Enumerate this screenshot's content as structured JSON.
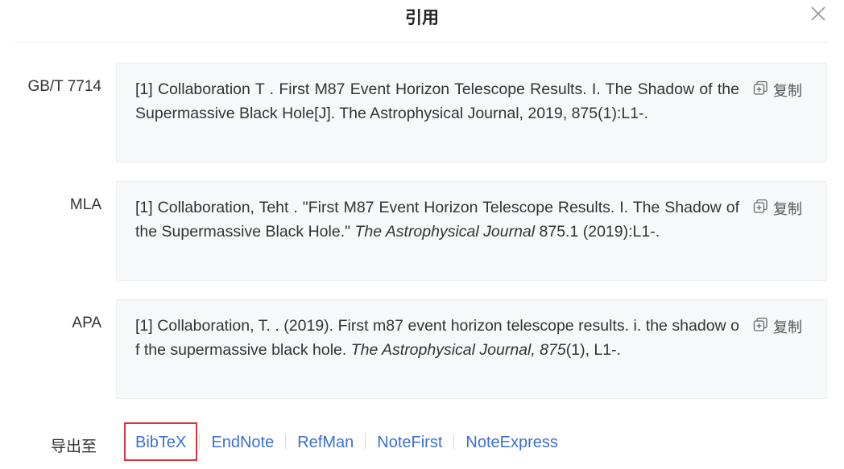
{
  "dialog": {
    "title": "引用",
    "close_icon": "close-icon"
  },
  "citations": [
    {
      "format": "GB/T 7714",
      "text": "[1] Collaboration T . First M87 Event Horizon Telescope Results. I. The Shadow of the Supermassive Black Hole[J]. The Astrophysical Journal, 2019, 875(1):L1-.",
      "copy_label": "复制"
    },
    {
      "format": "MLA",
      "text_before": "[1] Collaboration, Teht . \"First M87 Event Horizon Telescope Results. I. The Shadow of the Supermassive Black Hole.\" ",
      "text_italic": "The Astrophysical Journal",
      "text_after": " 875.1 (2019):L1-.",
      "copy_label": "复制"
    },
    {
      "format": "APA",
      "text_before": "[1] Collaboration, T. . (2019). First m87 event horizon telescope results. i. the shadow of the supermassive black hole. ",
      "text_italic": "The Astrophysical Journal, 875",
      "text_after": "(1), L1-.",
      "copy_label": "复制"
    }
  ],
  "export": {
    "label": "导出至",
    "links": [
      "BibTeX",
      "EndNote",
      "RefMan",
      "NoteFirst",
      "NoteExpress"
    ],
    "selected": "BibTeX"
  },
  "colors": {
    "link": "#3a6fd8",
    "selected_outline": "#d9363e",
    "box_background": "#f7f8fa"
  }
}
